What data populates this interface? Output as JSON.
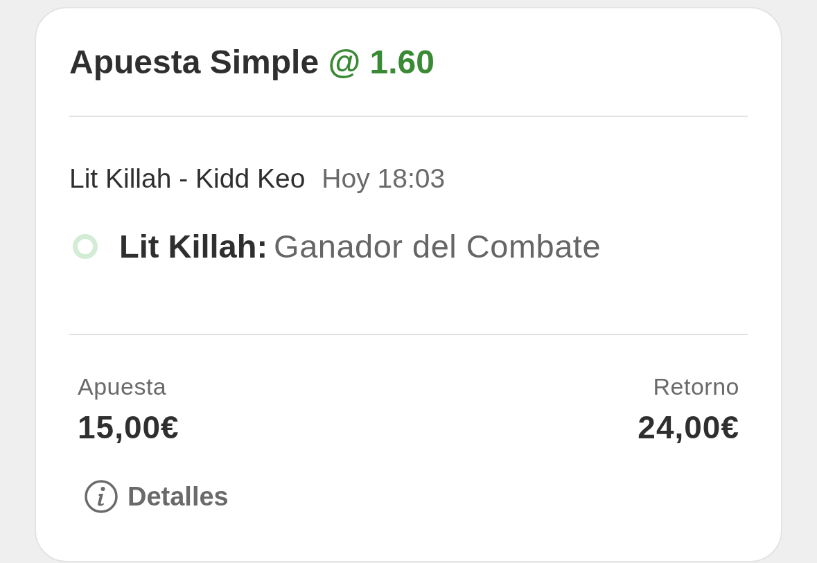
{
  "bet": {
    "title": "Apuesta Simple",
    "odds": "@ 1.60"
  },
  "event": {
    "name": "Lit Killah - Kidd Keo",
    "time": "Hoy 18:03"
  },
  "selection": {
    "pick": "Lit Killah:",
    "market": "Ganador del Combate"
  },
  "summary": [
    {
      "label": "Apuesta",
      "value": "15,00€"
    },
    {
      "label": "Retorno",
      "value": "24,00€"
    }
  ],
  "details_link": {
    "label": "Detalles"
  }
}
